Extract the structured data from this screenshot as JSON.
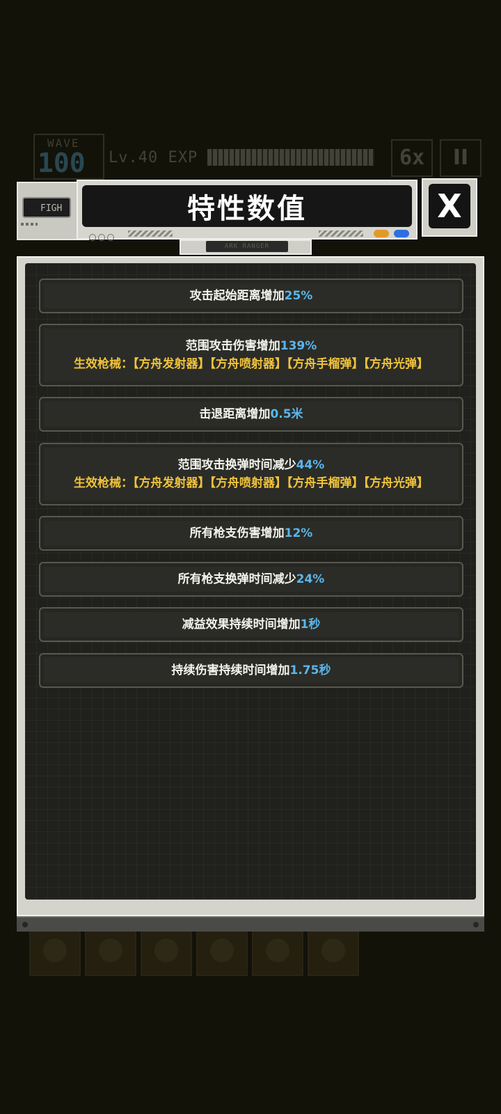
{
  "background_hud": {
    "wave_label": "WAVE",
    "wave_number": "100",
    "level_label": "Lv.40 EXP",
    "speed_label": "6x",
    "pause_label": "II"
  },
  "header": {
    "fight_label": "FIGH",
    "title": "特性数值",
    "close_label": "X",
    "subplate_label": "ARK RANGER"
  },
  "stats": [
    {
      "text": "攻击起始距离增加",
      "value": "25%"
    },
    {
      "text": "范围攻击伤害增加",
      "value": "139%",
      "weapons_prefix": "生效枪械：",
      "weapons": "【方舟发射器】【方舟喷射器】【方舟手榴弹】【方舟光弹】"
    },
    {
      "text": "击退距离增加",
      "value": "0.5米"
    },
    {
      "text": "范围攻击换弹时间减少",
      "value": "44%",
      "weapons_prefix": "生效枪械：",
      "weapons": "【方舟发射器】【方舟喷射器】【方舟手榴弹】【方舟光弹】"
    },
    {
      "text": "所有枪支伤害增加",
      "value": "12%"
    },
    {
      "text": "所有枪支换弹时间减少",
      "value": "24%"
    },
    {
      "text": "减益效果持续时间增加",
      "value": "1秒"
    },
    {
      "text": "持续伤害持续时间增加",
      "value": "1.75秒"
    }
  ],
  "colors": {
    "value_blue": "#5ab6ec",
    "weapon_yellow": "#f0c33c",
    "accent_orange": "#e09a2c",
    "accent_blue": "#2d6fe0"
  }
}
